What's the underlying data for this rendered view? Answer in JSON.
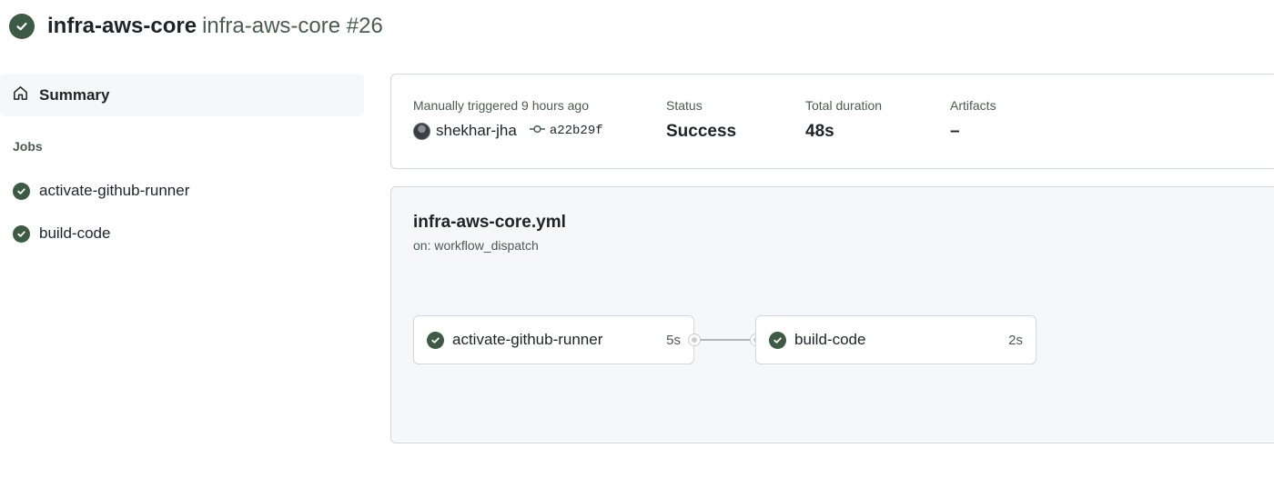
{
  "header": {
    "repo": "infra-aws-core",
    "run_title": "infra-aws-core #26",
    "status_icon": "check-circle-icon",
    "status_color": "#3d5a45"
  },
  "sidebar": {
    "summary_label": "Summary",
    "jobs_heading": "Jobs",
    "jobs": [
      {
        "label": "activate-github-runner",
        "icon": "check-circle-icon"
      },
      {
        "label": "build-code",
        "icon": "check-circle-icon"
      }
    ]
  },
  "summary": {
    "trigger_label": "Manually triggered 9 hours ago",
    "user": "shekhar-jha",
    "commit": "a22b29f",
    "status_label": "Status",
    "status_value": "Success",
    "duration_label": "Total duration",
    "duration_value": "48s",
    "artifacts_label": "Artifacts",
    "artifacts_value": "–"
  },
  "workflow": {
    "file": "infra-aws-core.yml",
    "trigger": "on: workflow_dispatch",
    "jobs": [
      {
        "name": "activate-github-runner",
        "duration": "5s"
      },
      {
        "name": "build-code",
        "duration": "2s"
      }
    ]
  }
}
